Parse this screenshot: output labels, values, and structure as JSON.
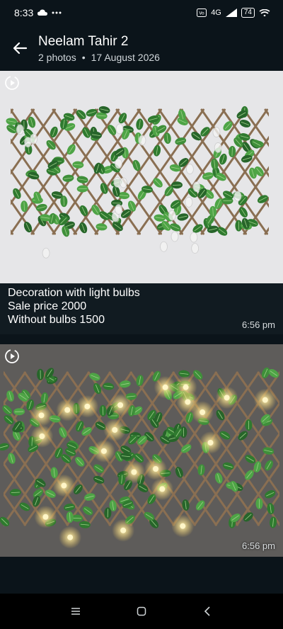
{
  "status_bar": {
    "time": "8:33",
    "signal_label": "4G",
    "battery": "74",
    "icons": [
      "cloud-icon",
      "more-icon",
      "volte-icon",
      "signal-icon",
      "battery-icon",
      "wifi-icon"
    ]
  },
  "header": {
    "chat_name": "Neelam Tahir 2",
    "photo_count": "2 photos",
    "date": "17 August 2026"
  },
  "messages": [
    {
      "caption_lines": [
        "Decoration with light bulbs",
        "Sale price 2000",
        "Without bulbs 1500"
      ],
      "time": "6:56 pm",
      "lights_on": false
    },
    {
      "caption_lines": [],
      "time": "6:56 pm",
      "lights_on": true
    }
  ],
  "nav": {
    "icons": [
      "recents-icon",
      "home-icon",
      "back-nav-icon"
    ]
  },
  "colors": {
    "background": "#0b141a",
    "caption_bar": "#111b21",
    "leaf": "#3f8f3a",
    "lattice": "#8a6f52",
    "bulb_glow": "#ffd25a"
  }
}
